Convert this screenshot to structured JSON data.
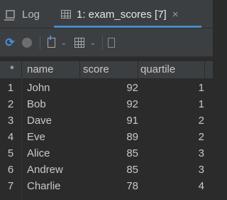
{
  "tabs": {
    "log_label": "Log",
    "active_label": "1: exam_scores [7]",
    "close_symbol": "×"
  },
  "toolbar": {
    "refresh_icon": "⟳",
    "dropdown_symbol": "⌄"
  },
  "table": {
    "corner": "*",
    "columns": [
      "name",
      "score",
      "quartile"
    ],
    "rows": [
      {
        "idx": "1",
        "name": "John",
        "score": "92",
        "quartile": "1"
      },
      {
        "idx": "2",
        "name": "Bob",
        "score": "92",
        "quartile": "1"
      },
      {
        "idx": "3",
        "name": "Dave",
        "score": "91",
        "quartile": "2"
      },
      {
        "idx": "4",
        "name": "Eve",
        "score": "89",
        "quartile": "2"
      },
      {
        "idx": "5",
        "name": "Alice",
        "score": "85",
        "quartile": "3"
      },
      {
        "idx": "6",
        "name": "Andrew",
        "score": "85",
        "quartile": "3"
      },
      {
        "idx": "7",
        "name": "Charlie",
        "score": "78",
        "quartile": "4"
      }
    ]
  },
  "colors": {
    "accent": "#4a88c7",
    "background": "#2b2b2b",
    "panel": "#3c3f41"
  }
}
